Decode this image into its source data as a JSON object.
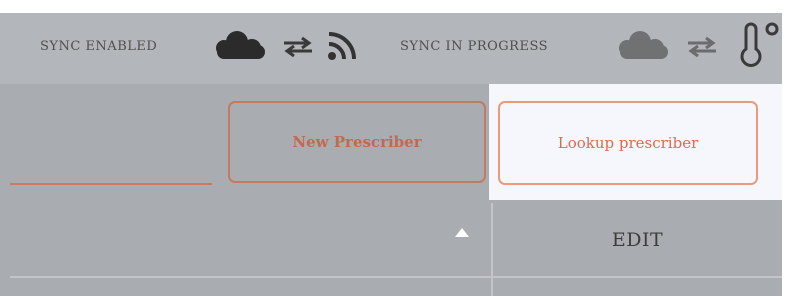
{
  "status_bar": {
    "sync_enabled_label": "SYNC ENABLED",
    "sync_in_progress_label": "SYNC IN PROGRESS",
    "icons": [
      "cloud-icon",
      "sync-arrows-icon",
      "rss-feed-icon",
      "cloud-icon",
      "sync-arrows-icon",
      "thermometer-icon"
    ]
  },
  "actions": {
    "new_prescriber_label": "New Prescriber",
    "lookup_prescriber_label": "Lookup prescriber"
  },
  "table": {
    "columns": [
      {
        "label": "",
        "sort": "ascending"
      },
      {
        "label": "EDIT"
      }
    ]
  },
  "colors": {
    "accent": "#e2694b",
    "toolbar_bg": "#b3b6ba",
    "panel_bg": "#a9acb0",
    "highlight_bg": "#f5f7fc"
  }
}
